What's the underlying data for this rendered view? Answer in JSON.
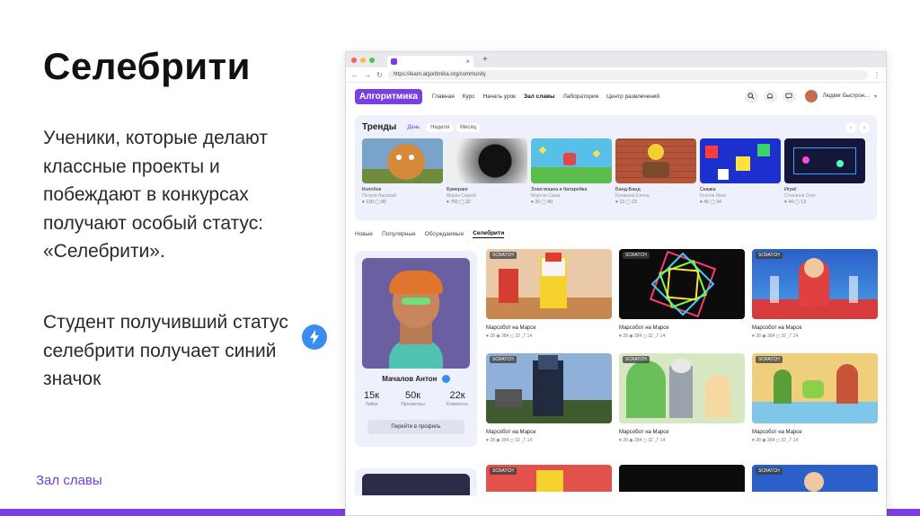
{
  "slide": {
    "title": "Селебрити",
    "paragraph1": "Ученики, которые делают классные проекты и побеждают в конкурсах получают особый статус: «Селебрити».",
    "paragraph2": "Студент получивший статус селебрити получает синий значок",
    "footer": "Зал славы",
    "accent_color": "#7c3fe0",
    "badge_color": "#3a8df0"
  },
  "browser": {
    "url": "https://learn.algoritmika.org/community",
    "new_tab": "+",
    "close_tab": "×"
  },
  "site": {
    "logo": "Алгоритмика",
    "nav": [
      "Главная",
      "Курс",
      "Начать урок",
      "Зал славы",
      "Лаборатория",
      "Центр развлечений"
    ],
    "active_nav": "Зал славы",
    "username": "Людвиг Быстрон...",
    "icons": [
      "search-icon",
      "bell-icon",
      "chat-icon"
    ]
  },
  "trends": {
    "title": "Тренды",
    "periods": [
      "День",
      "Неделя",
      "Месяц"
    ],
    "active_period": "День",
    "cards": [
      {
        "name": "Колобок",
        "author": "Петров Василий",
        "stats": "♥ 120 ◯ 80"
      },
      {
        "name": "Бумеранг",
        "author": "Мороз Сергей",
        "stats": "♥ 760 ◯ 32"
      },
      {
        "name": "Злая вошка и батарейка",
        "author": "Морсов Саша",
        "stats": "♥ 20 ◯ 40"
      },
      {
        "name": "Банд-Банд",
        "author": "Конакова Елена",
        "stats": "♥ 13 ◯ 23"
      },
      {
        "name": "Сказка",
        "author": "Козлов Иван",
        "stats": "♥ 45 ◯ 34"
      },
      {
        "name": "Игра!",
        "author": "Степанов Олег",
        "stats": "♥ 44 ◯ 13"
      }
    ]
  },
  "tabs": [
    "Новые",
    "Популярные",
    "Обсуждаемые",
    "Селебрити"
  ],
  "active_tab": "Селебрити",
  "profile": {
    "name": "Мачалов Антон",
    "stats": [
      {
        "value": "15к",
        "label": "Лайки"
      },
      {
        "value": "50к",
        "label": "Просмотры"
      },
      {
        "value": "22к",
        "label": "Комменты"
      }
    ],
    "button": "Перейти в профиль"
  },
  "projects": [
    {
      "tag": "SCRATCH",
      "title": "Марсобот на Марсе",
      "stats": "♥ 28  ◉ 384  ◻ 32  ⤴ 14"
    },
    {
      "tag": "SCRATCH",
      "title": "Марсобот на Марсе",
      "stats": "♥ 28  ◉ 384  ◻ 32  ⤴ 14"
    },
    {
      "tag": "SCRATCH",
      "title": "Марсобот на Марсе",
      "stats": "♥ 28  ◉ 384  ◻ 32  ⤴ 14"
    },
    {
      "tag": "SCRATCH",
      "title": "Марсобот на Марсе",
      "stats": "♥ 28  ◉ 384  ◻ 32  ⤴ 14"
    },
    {
      "tag": "SCRATCH",
      "title": "Марсобот на Марсе",
      "stats": "♥ 28  ◉ 384  ◻ 32  ⤴ 14"
    },
    {
      "tag": "SCRATCH",
      "title": "Марсобот на Марсе",
      "stats": "♥ 28  ◉ 384  ◻ 32  ⤴ 14"
    }
  ],
  "bottom_row_tags": [
    "SCRATCH",
    "SCRATCH"
  ]
}
